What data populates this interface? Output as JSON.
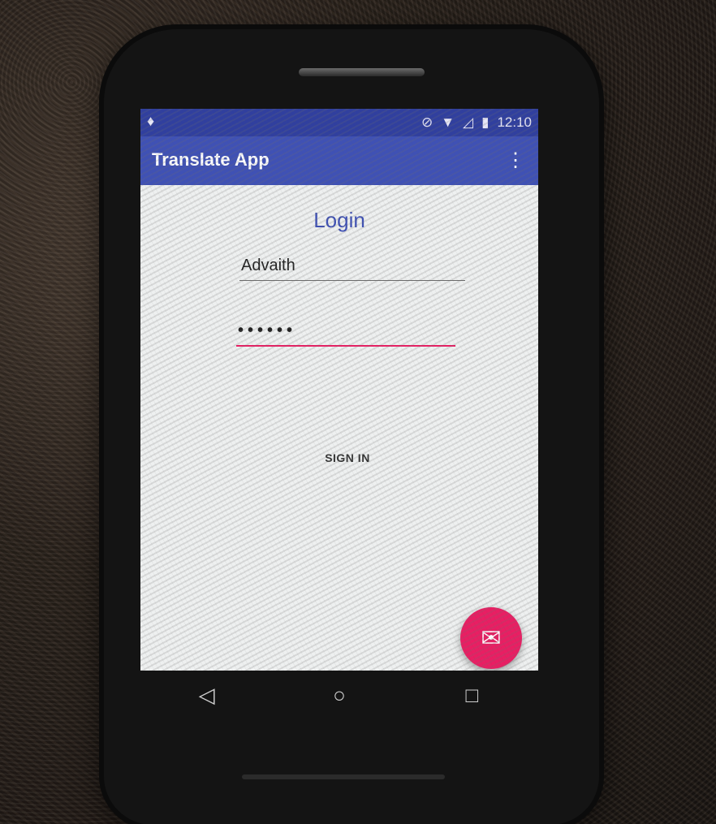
{
  "status_bar": {
    "left_icon": "notification-icon",
    "time": "12:10",
    "icons": [
      "do-not-disturb-icon",
      "wifi-icon",
      "signal-icon",
      "battery-icon"
    ]
  },
  "app_bar": {
    "title": "Translate App",
    "menu_icon": "overflow-menu-icon"
  },
  "login": {
    "title": "Login",
    "username_value": "Advaith",
    "password_value": "••••••",
    "sign_in_label": "SIGN IN"
  },
  "fab": {
    "icon": "email-icon"
  },
  "nav_bar": {
    "icons": [
      "back-icon",
      "home-icon",
      "recents-icon"
    ]
  },
  "colors": {
    "primary": "#3f51b5",
    "primary_dark": "#303f9f",
    "accent": "#e91e63"
  }
}
